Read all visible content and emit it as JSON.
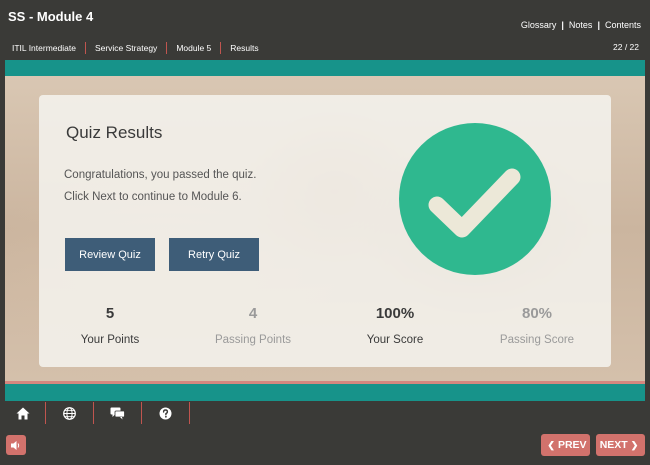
{
  "header": {
    "title": "SS - Module 4",
    "links": [
      "Glossary",
      "Notes",
      "Contents"
    ],
    "link_separator": "|"
  },
  "breadcrumb": [
    "ITIL Intermediate",
    "Service Strategy",
    "Module 5",
    "Results"
  ],
  "page_counter": "22 / 22",
  "card": {
    "title": "Quiz Results",
    "message_line1": "Congratulations, you passed the quiz.",
    "message_line2": "Click Next to continue to Module 6.",
    "review_button": "Review Quiz",
    "retry_button": "Retry Quiz"
  },
  "stats": [
    {
      "value": "5",
      "label": "Your Points"
    },
    {
      "value": "4",
      "label": "Passing Points"
    },
    {
      "value": "100%",
      "label": "Your Score"
    },
    {
      "value": "80%",
      "label": "Passing Score"
    }
  ],
  "toolbar_icons": [
    "home-icon",
    "globe-icon",
    "chat-icon",
    "help-icon"
  ],
  "nav": {
    "prev": "PREV",
    "next": "NEXT"
  },
  "colors": {
    "background": "#3a3a37",
    "teal": "#17938a",
    "button": "#3e5d78",
    "check": "#2fb88f",
    "nav_button": "#d2726c"
  }
}
